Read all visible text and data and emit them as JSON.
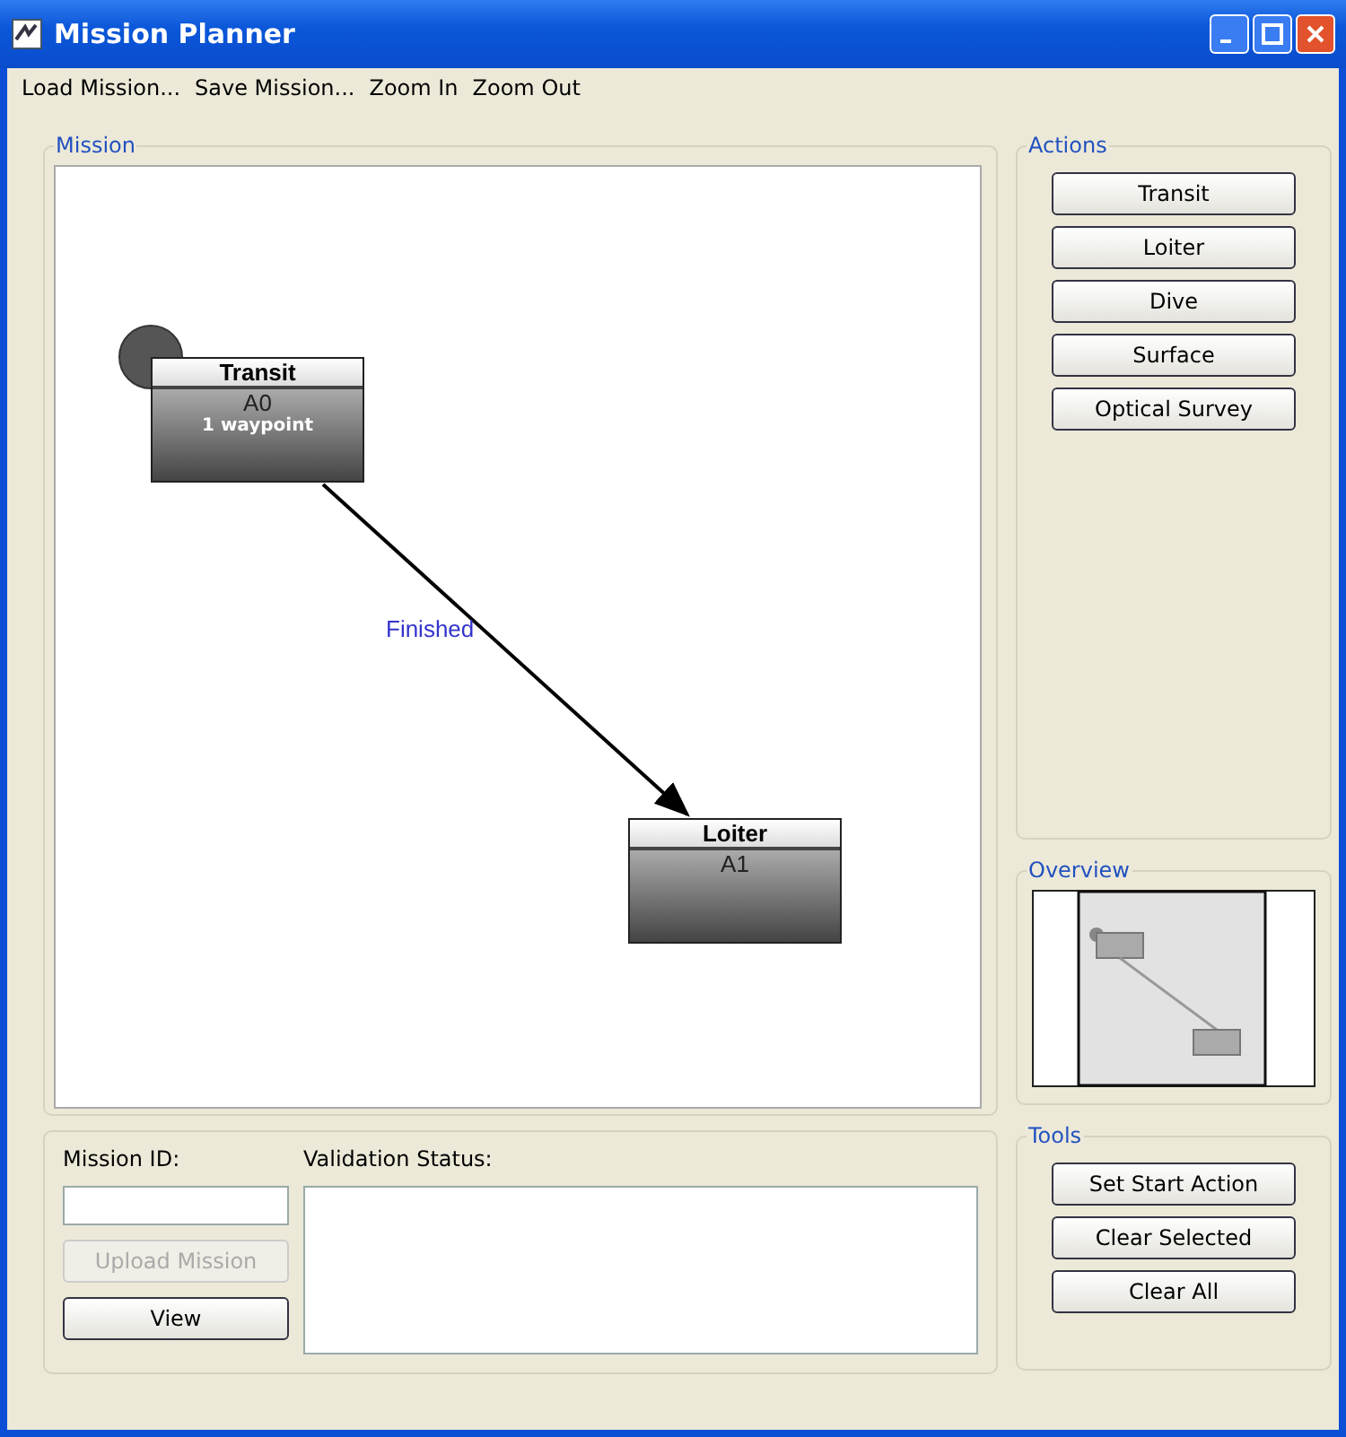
{
  "window": {
    "title": "Mission Planner"
  },
  "menu": [
    {
      "label": "Load Mission..."
    },
    {
      "label": "Save Mission..."
    },
    {
      "label": "Zoom In"
    },
    {
      "label": "Zoom Out"
    }
  ],
  "mission": {
    "title": "Mission",
    "nodes": [
      {
        "title": "Transit",
        "id": "A0",
        "detail": "1 waypoint",
        "start": true
      },
      {
        "title": "Loiter",
        "id": "A1",
        "start": false
      }
    ],
    "edges": [
      {
        "label": "Finished"
      }
    ]
  },
  "actions": {
    "title": "Actions",
    "buttons": [
      "Transit",
      "Loiter",
      "Dive",
      "Surface",
      "Optical Survey"
    ]
  },
  "overview": {
    "title": "Overview"
  },
  "mission_id": {
    "label": "Mission ID:"
  },
  "upload_button": {
    "label": "Upload Mission",
    "disabled": true
  },
  "view_button": {
    "label": "View",
    "disabled": false
  },
  "validation": {
    "label": "Validation Status:"
  },
  "tools": {
    "title": "Tools",
    "buttons": [
      "Set Start Action",
      "Clear Selected",
      "Clear All"
    ]
  }
}
